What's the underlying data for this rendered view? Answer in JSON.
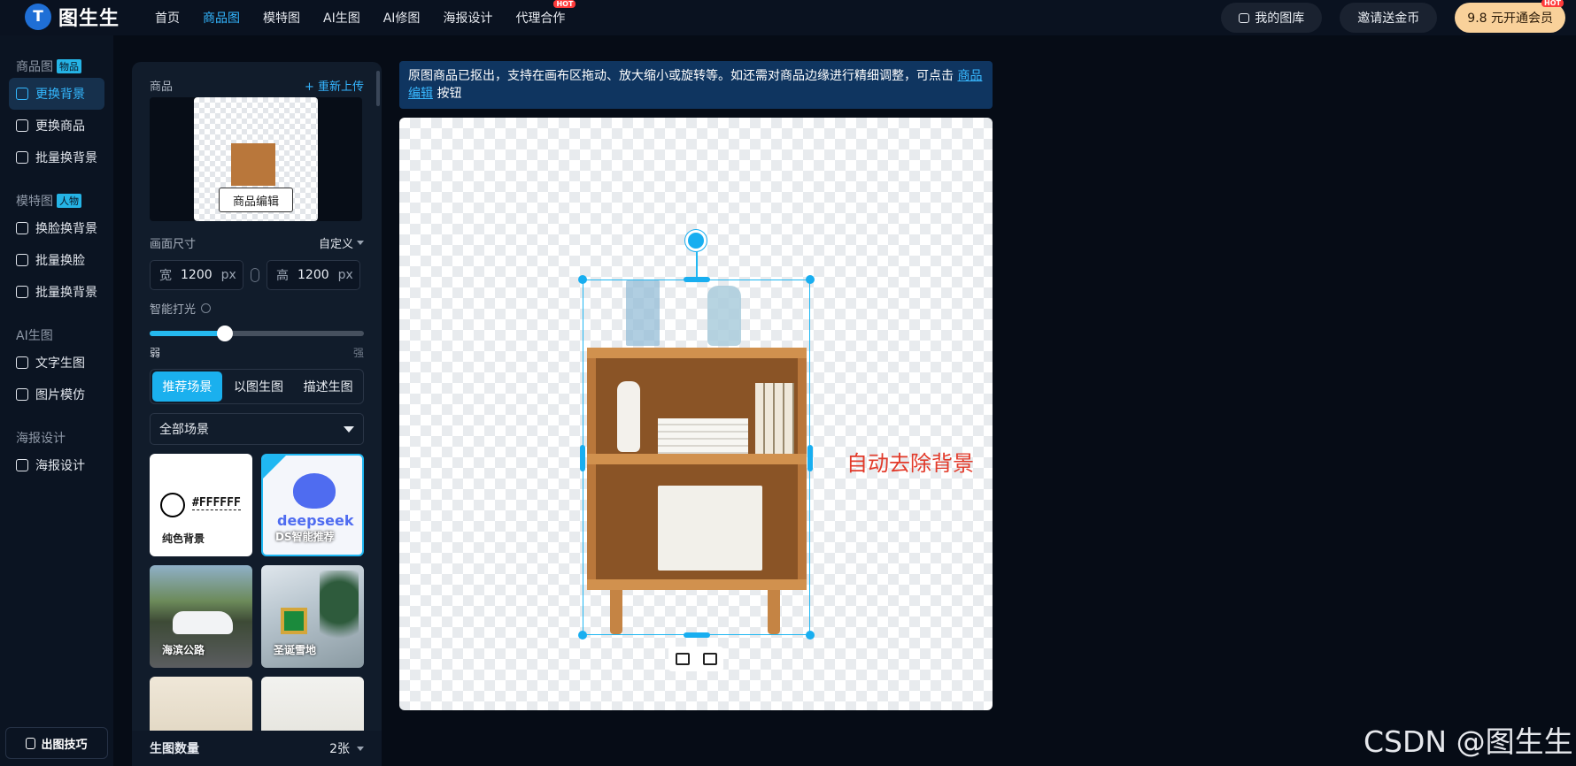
{
  "app": {
    "name": "图生生"
  },
  "nav": {
    "items": [
      {
        "label": "首页",
        "active": false
      },
      {
        "label": "商品图",
        "active": true
      },
      {
        "label": "模特图",
        "active": false
      },
      {
        "label": "AI生图",
        "active": false
      },
      {
        "label": "AI修图",
        "active": false
      },
      {
        "label": "海报设计",
        "active": false
      },
      {
        "label": "代理合作",
        "active": false,
        "badge": "HOT"
      }
    ]
  },
  "topright": {
    "library": "我的图库",
    "invite": "邀请送金币",
    "vip": "9.8 元开通会员",
    "vip_badge": "HOT"
  },
  "sidebar": {
    "groups": [
      {
        "title": "商品图",
        "tag": "物品",
        "items": [
          {
            "label": "更换背景",
            "active": true,
            "icon": "image-swap-icon"
          },
          {
            "label": "更换商品",
            "active": false,
            "icon": "swap-icon"
          },
          {
            "label": "批量换背景",
            "active": false,
            "icon": "batch-image-icon"
          }
        ]
      },
      {
        "title": "模特图",
        "tag": "人物",
        "items": [
          {
            "label": "换脸换背景",
            "active": false,
            "icon": "face-swap-icon"
          },
          {
            "label": "批量换脸",
            "active": false,
            "icon": "batch-face-icon"
          },
          {
            "label": "批量换背景",
            "active": false,
            "icon": "batch-image-icon"
          }
        ]
      },
      {
        "title": "AI生图",
        "tag": "",
        "items": [
          {
            "label": "文字生图",
            "active": false,
            "icon": "text-image-icon"
          },
          {
            "label": "图片模仿",
            "active": false,
            "icon": "image-copy-icon"
          }
        ]
      },
      {
        "title": "海报设计",
        "tag": "",
        "items": [
          {
            "label": "海报设计",
            "active": false,
            "icon": "poster-icon"
          }
        ]
      }
    ],
    "tips": "出图技巧"
  },
  "panel": {
    "product_label": "商品",
    "reupload": "+ 重新上传",
    "edit_button": "商品编辑",
    "size_label": "画面尺寸",
    "size_mode": "自定义",
    "width_label": "宽",
    "width_value": "1200",
    "height_label": "高",
    "height_value": "1200",
    "unit": "px",
    "light_label": "智能打光",
    "light_value": 0.35,
    "light_min": "弱",
    "light_max": "强",
    "tabs": [
      {
        "label": "推荐场景",
        "active": true
      },
      {
        "label": "以图生图",
        "active": false
      },
      {
        "label": "描述生图",
        "active": false
      }
    ],
    "scene_select": "全部场景",
    "scenes": [
      {
        "label": "纯色背景",
        "hex": "#FFFFFF",
        "type": "solid"
      },
      {
        "label": "DS智能推荐",
        "brand": "deepseek",
        "type": "ds"
      },
      {
        "label": "海滨公路",
        "type": "road"
      },
      {
        "label": "圣诞雪地",
        "type": "xmas"
      },
      {
        "label": "",
        "type": "plant1"
      },
      {
        "label": "",
        "type": "plant2"
      }
    ],
    "count_label": "生图数量",
    "count_value": "2张"
  },
  "notice": {
    "text": "原图商品已抠出，支持在画布区拖动、放大缩小或旋转等。如还需对商品边缘进行精细调整，可点击",
    "link": "商品编辑",
    "suffix": "按钮"
  },
  "annotation": "自动去除背景",
  "watermark": "CSDN @图生生",
  "colors": {
    "accent": "#20b7f2",
    "annotation": "#e23a2a",
    "vip": "#f9d19a"
  }
}
